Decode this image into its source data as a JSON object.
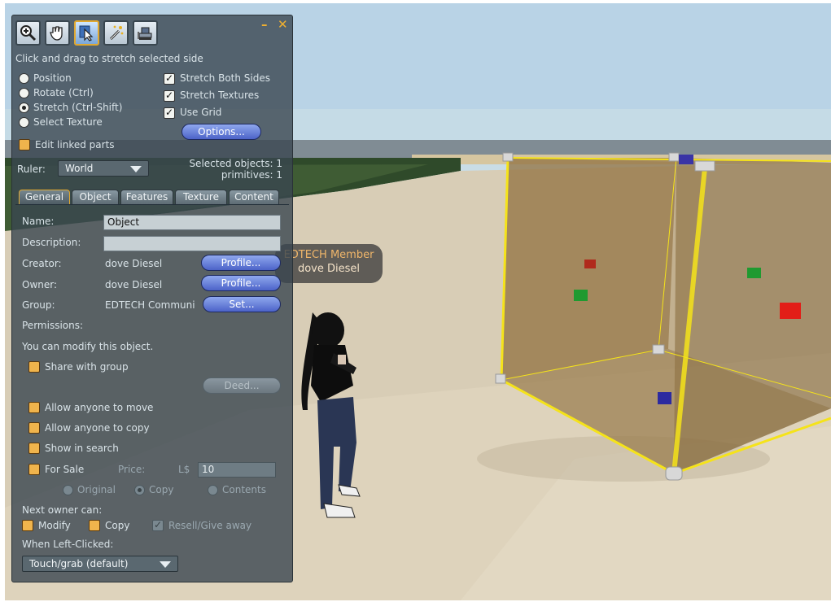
{
  "colors": {
    "accent_orange": "#f0b030",
    "selection_yellow": "#f5e31a",
    "button_blue": "#5b72d4",
    "panel_bg": "#3a4650"
  },
  "toolbar": {
    "tools": [
      {
        "icon": "zoom-tool-icon",
        "active": false
      },
      {
        "icon": "grab-hand-tool-icon",
        "active": false
      },
      {
        "icon": "edit-pointer-tool-icon",
        "active": true
      },
      {
        "icon": "create-wand-tool-icon",
        "active": false
      },
      {
        "icon": "land-bulldozer-tool-icon",
        "active": false
      }
    ],
    "minimize_label": "–",
    "close_label": "✕"
  },
  "edit": {
    "hint": "Click and drag to stretch selected side",
    "modes": {
      "position": "Position",
      "rotate": "Rotate (Ctrl)",
      "stretch": "Stretch (Ctrl-Shift)",
      "select_texture": "Select Texture",
      "selected": "stretch"
    },
    "options": {
      "stretch_both_sides": "Stretch Both Sides",
      "stretch_textures": "Stretch Textures",
      "use_grid": "Use Grid",
      "options_button": "Options..."
    },
    "edit_linked": "Edit linked parts",
    "ruler_label": "Ruler:",
    "ruler_value": "World",
    "selected_objects": "Selected objects: 1",
    "primitives": "primitives: 1"
  },
  "tabs": [
    "General",
    "Object",
    "Features",
    "Texture",
    "Content"
  ],
  "active_tab": "General",
  "general": {
    "name_label": "Name:",
    "name_value": "Object",
    "description_label": "Description:",
    "description_value": "",
    "creator_label": "Creator:",
    "creator_value": "dove Diesel",
    "owner_label": "Owner:",
    "owner_value": "dove Diesel",
    "group_label": "Group:",
    "group_value": "EDTECH Communi",
    "profile_button": "Profile...",
    "set_button": "Set...",
    "permissions_label": "Permissions:",
    "modify_note": "You can modify this object.",
    "share_with_group": "Share with group",
    "deed_button": "Deed...",
    "allow_move": "Allow anyone to move",
    "allow_copy": "Allow anyone to copy",
    "show_in_search": "Show in search",
    "for_sale": "For Sale",
    "price_label": "Price:",
    "currency": "L$",
    "price_value": "10",
    "sale_types": [
      "Original",
      "Copy",
      "Contents"
    ],
    "next_owner_label": "Next owner can:",
    "next_modify": "Modify",
    "next_copy": "Copy",
    "next_resell": "Resell/Give away",
    "left_click_label": "When Left-Clicked:",
    "left_click_value": "Touch/grab (default)"
  },
  "avatar_tag": {
    "group": "EDTECH Member",
    "name": "dove Diesel"
  }
}
